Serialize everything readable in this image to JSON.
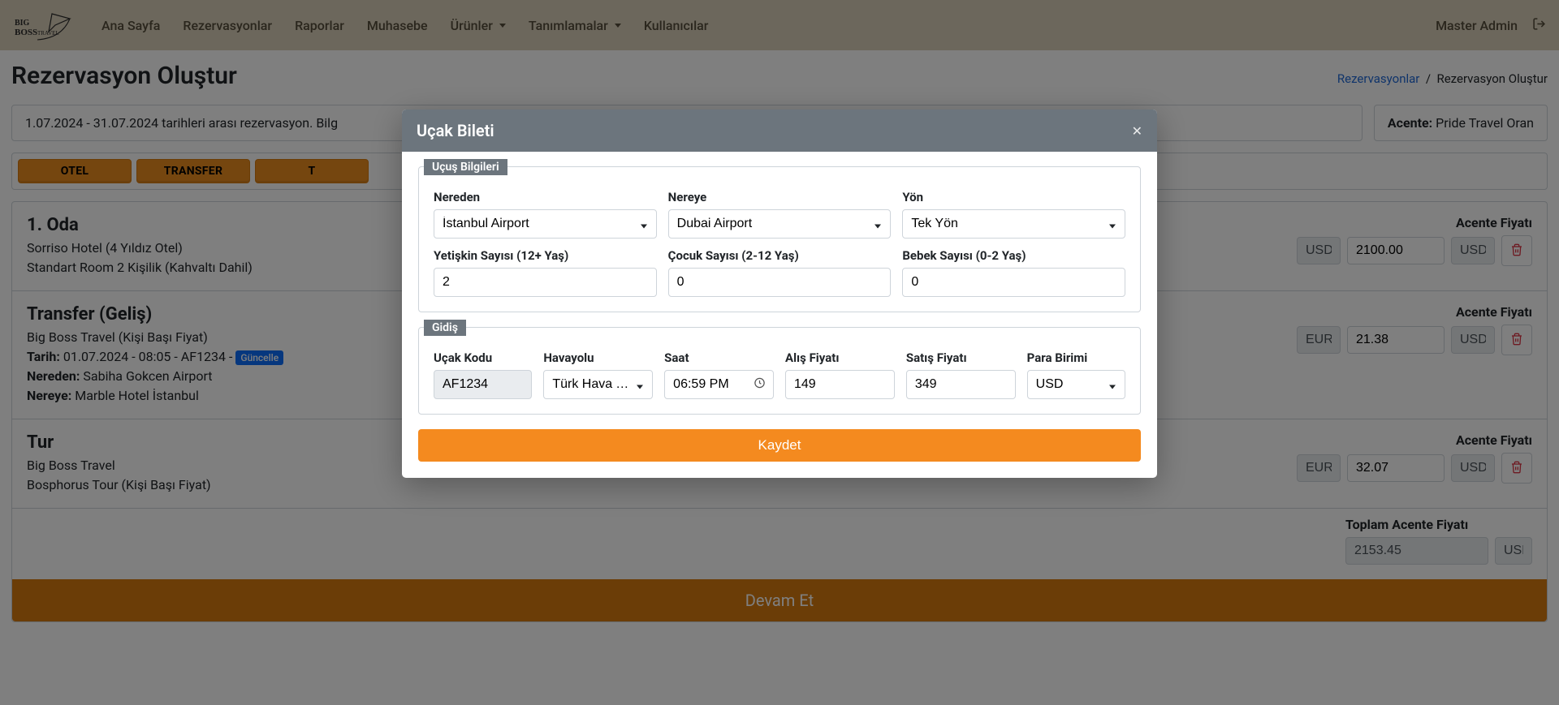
{
  "nav": {
    "items": [
      "Ana Sayfa",
      "Rezervasyonlar",
      "Raporlar",
      "Muhasebe",
      "Ürünler",
      "Tanımlamalar",
      "Kullanıcılar"
    ],
    "dropdowns": {
      "Ürünler": true,
      "Tanımlamalar": true
    },
    "user": "Master Admin"
  },
  "page": {
    "title": "Rezervasyon Oluştur",
    "breadcrumb": {
      "link": "Rezervasyonlar",
      "current": "Rezervasyon Oluştur"
    },
    "date_info_prefix": "1.07.2024 - 31.07.2024 tarihleri arası rezervasyon. Bilg",
    "agency_label": "Acente:",
    "agency_name": "Pride Travel Oran",
    "quick_buttons": [
      "OTEL",
      "TRANSFER",
      "T"
    ]
  },
  "items": [
    {
      "title": "1. Oda",
      "lines": [
        "Sorriso Hotel (4 Yıldız Otel)",
        "Standart Room 2 Kişilik (Kahvaltı Dahil)"
      ],
      "price_label": "Acente Fiyatı",
      "cur_left": "USD",
      "value": "2100.00",
      "cur_right": "USD"
    },
    {
      "title": "Transfer (Geliş)",
      "company": "Big Boss Travel (Kişi Başı Fiyat)",
      "tarih_label": "Tarih:",
      "tarih_value": "01.07.2024 - 08:05 - AF1234 -",
      "badge": "Güncelle",
      "nereden_label": "Nereden:",
      "nereden_value": "Sabiha Gokcen Airport",
      "nereye_label": "Nereye:",
      "nereye_value": "Marble Hotel İstanbul",
      "price_label": "Acente Fiyatı",
      "cur_left": "EUR",
      "value": "21.38",
      "cur_right": "USD"
    },
    {
      "title": "Tur",
      "lines": [
        "Big Boss Travel",
        "Bosphorus Tour (Kişi Başı Fiyat)"
      ],
      "price_label": "Acente Fiyatı",
      "cur_left": "EUR",
      "value": "32.07",
      "cur_right": "USD"
    }
  ],
  "total": {
    "label": "Toplam Acente Fiyatı",
    "value": "2153.45",
    "cur": "USD"
  },
  "continue_label": "Devam Et",
  "modal": {
    "title": "Uçak Bileti",
    "section_flight": "Uçuş Bilgileri",
    "section_dep": "Gidiş",
    "fields": {
      "from_label": "Nereden",
      "from_value": "İstanbul Airport",
      "to_label": "Nereye",
      "to_value": "Dubai Airport",
      "direction_label": "Yön",
      "direction_value": "Tek Yön",
      "adult_label": "Yetişkin Sayısı (12+ Yaş)",
      "adult_value": "2",
      "child_label": "Çocuk Sayısı (2-12 Yaş)",
      "child_value": "0",
      "baby_label": "Bebek Sayısı (0-2 Yaş)",
      "baby_value": "0",
      "code_label": "Uçak Kodu",
      "code_value": "AF1234",
      "airline_label": "Havayolu",
      "airline_value": "Türk Hava Yolları",
      "time_label": "Saat",
      "time_value": "06:59 PM",
      "buy_label": "Alış Fiyatı",
      "buy_value": "149",
      "sell_label": "Satış Fiyatı",
      "sell_value": "349",
      "currency_label": "Para Birimi",
      "currency_value": "USD"
    },
    "save": "Kaydet"
  }
}
